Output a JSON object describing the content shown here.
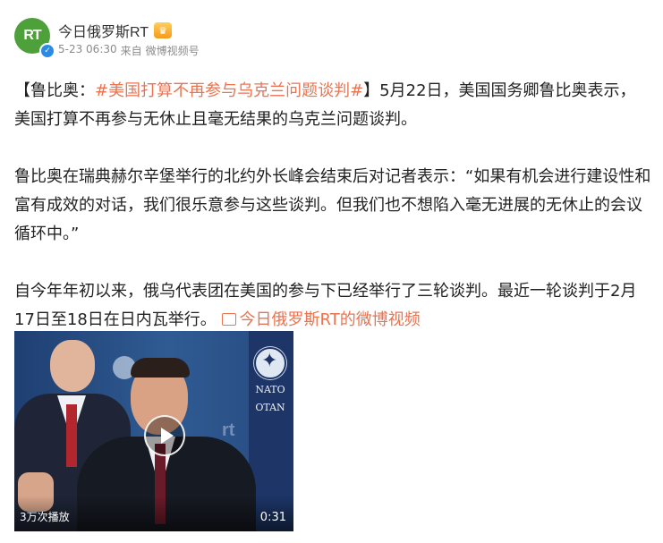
{
  "author": {
    "avatar_text": "RT",
    "name": "今日俄罗斯RT",
    "verified_color": "#2b8ae6",
    "crown_icon": "crown-icon"
  },
  "meta": {
    "time": "5-23 06:30",
    "from_label": "来自",
    "source": "微博视频号"
  },
  "post": {
    "p1_open": "【",
    "p1_name": "鲁比奥：",
    "p1_tag": "#美国打算不再参与乌克兰问题谈判#",
    "p1_rest": "】5月22日，美国国务卿鲁比奥表示，美国打算不再参与无休止且毫无结果的乌克兰问题谈判。",
    "p2": "鲁比奥在瑞典赫尔辛堡举行的北约外长峰会结束后对记者表示：“如果有机会进行建设性和富有成效的对话，我们很乐意参与这些谈判。但我们也不想陷入毫无进展的无休止的会议循环中。”",
    "p3": "自今年年初以来，俄乌代表团在美国的参与下已经举行了三轮谈判。最近一轮谈判于2月17日至18日在日内瓦举行。",
    "video_link": "今日俄罗斯RT的微博视频"
  },
  "video": {
    "views": "3万次播放",
    "duration": "0:31",
    "nato_line1": "NATO",
    "nato_line2": "OTAN",
    "watermark": "rt"
  },
  "colors": {
    "link": "#eb7350",
    "avatar_bg": "#4ea03a"
  }
}
